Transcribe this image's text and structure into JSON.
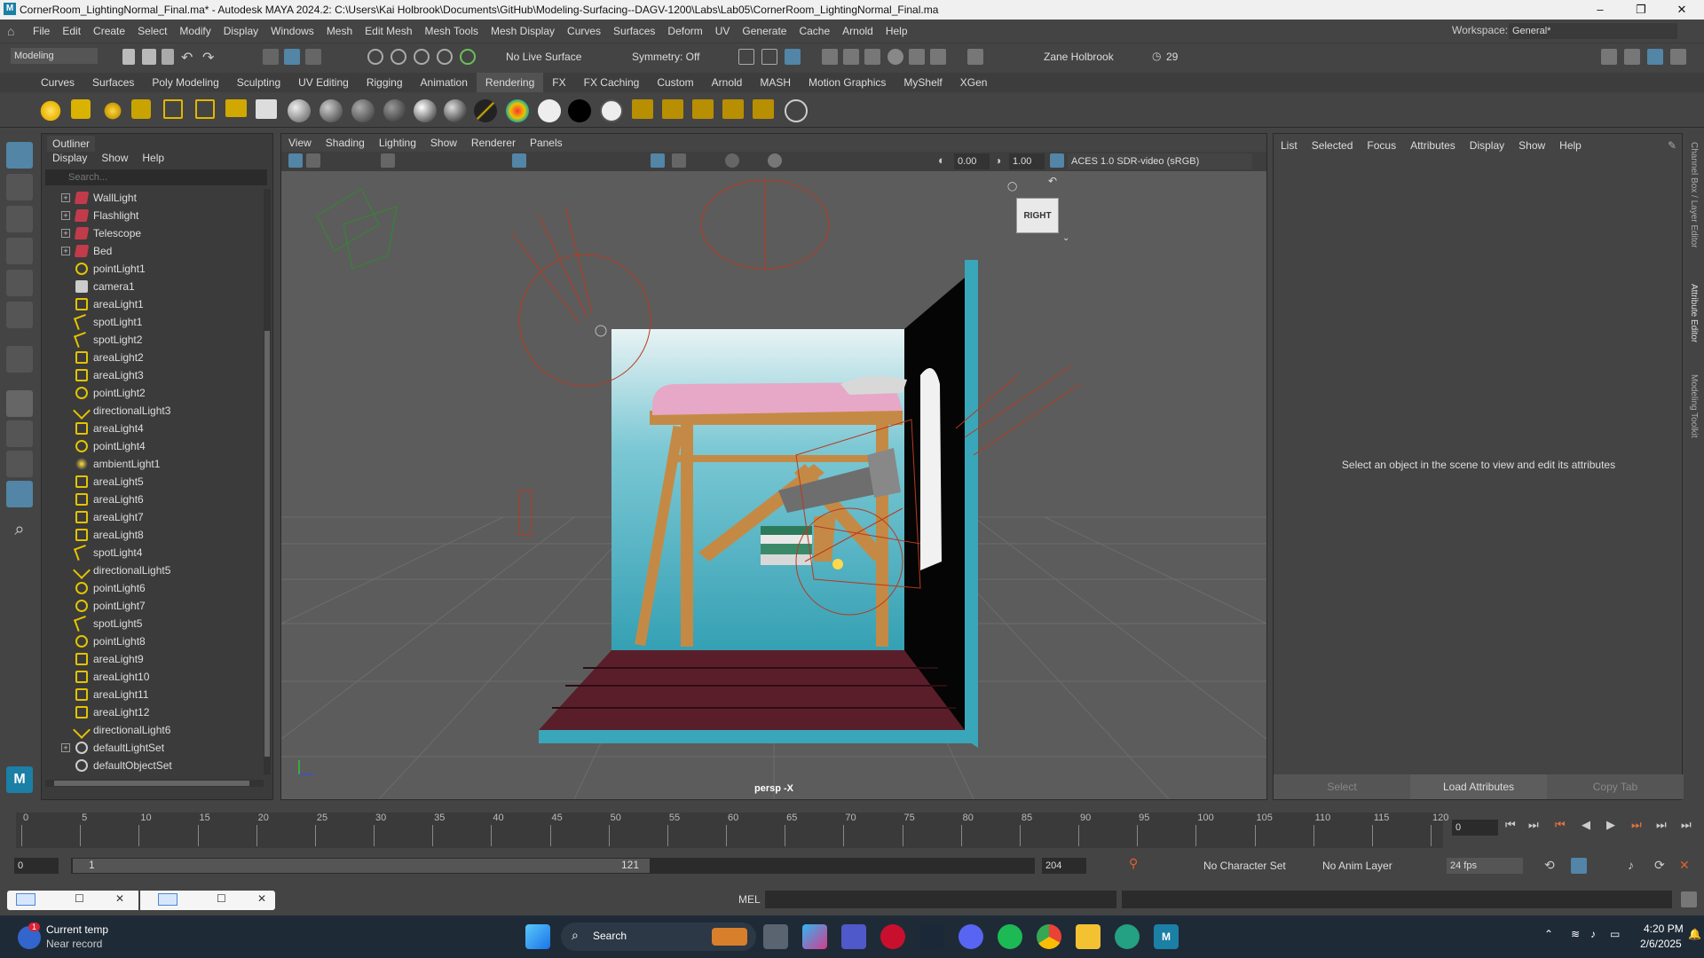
{
  "window": {
    "title": "CornerRoom_LightingNormal_Final.ma* - Autodesk MAYA 2024.2: C:\\Users\\Kai Holbrook\\Documents\\GitHub\\Modeling-Surfacing--DAGV-1200\\Labs\\Lab05\\CornerRoom_LightingNormal_Final.ma",
    "logo": "M",
    "minimize": "–",
    "restore": "❐",
    "close": "✕"
  },
  "menu": [
    "File",
    "Edit",
    "Create",
    "Select",
    "Modify",
    "Display",
    "Windows",
    "Mesh",
    "Edit Mesh",
    "Mesh Tools",
    "Mesh Display",
    "Curves",
    "Surfaces",
    "Deform",
    "UV",
    "Generate",
    "Cache",
    "Arnold",
    "Help"
  ],
  "workspace": {
    "label": "Workspace:",
    "value": "General*"
  },
  "status": {
    "mode": "Modeling",
    "live_surface": "No Live Surface",
    "symmetry": "Symmetry: Off",
    "user": "Zane Holbrook",
    "count": "29"
  },
  "shelf_tabs": [
    "Curves",
    "Surfaces",
    "Poly Modeling",
    "Sculpting",
    "UV Editing",
    "Rigging",
    "Animation",
    "Rendering",
    "FX",
    "FX Caching",
    "Custom",
    "Arnold",
    "MASH",
    "Motion Graphics",
    "MyShelf",
    "XGen"
  ],
  "shelf_active": "Rendering",
  "outliner": {
    "tab": "Outliner",
    "menu": [
      "Display",
      "Show",
      "Help"
    ],
    "search_placeholder": "Search...",
    "items": [
      {
        "label": "WallLight",
        "icon": "group-icon",
        "expand": true
      },
      {
        "label": "Flashlight",
        "icon": "group-icon",
        "expand": true
      },
      {
        "label": "Telescope",
        "icon": "group-icon",
        "expand": true
      },
      {
        "label": "Bed",
        "icon": "group-icon",
        "expand": true
      },
      {
        "label": "pointLight1",
        "icon": "point-light-icon"
      },
      {
        "label": "camera1",
        "icon": "camera-icon"
      },
      {
        "label": "areaLight1",
        "icon": "area-light-icon"
      },
      {
        "label": "spotLight1",
        "icon": "spot-light-icon"
      },
      {
        "label": "spotLight2",
        "icon": "spot-light-icon"
      },
      {
        "label": "areaLight2",
        "icon": "area-light-icon"
      },
      {
        "label": "areaLight3",
        "icon": "area-light-icon"
      },
      {
        "label": "pointLight2",
        "icon": "point-light-icon"
      },
      {
        "label": "directionalLight3",
        "icon": "directional-light-icon"
      },
      {
        "label": "areaLight4",
        "icon": "area-light-icon"
      },
      {
        "label": "pointLight4",
        "icon": "point-light-icon"
      },
      {
        "label": "ambientLight1",
        "icon": "ambient-light-icon"
      },
      {
        "label": "areaLight5",
        "icon": "area-light-icon"
      },
      {
        "label": "areaLight6",
        "icon": "area-light-icon"
      },
      {
        "label": "areaLight7",
        "icon": "area-light-icon"
      },
      {
        "label": "areaLight8",
        "icon": "area-light-icon"
      },
      {
        "label": "spotLight4",
        "icon": "spot-light-icon"
      },
      {
        "label": "directionalLight5",
        "icon": "directional-light-icon"
      },
      {
        "label": "pointLight6",
        "icon": "point-light-icon"
      },
      {
        "label": "pointLight7",
        "icon": "point-light-icon"
      },
      {
        "label": "spotLight5",
        "icon": "spot-light-icon"
      },
      {
        "label": "pointLight8",
        "icon": "point-light-icon"
      },
      {
        "label": "areaLight9",
        "icon": "area-light-icon"
      },
      {
        "label": "areaLight10",
        "icon": "area-light-icon"
      },
      {
        "label": "areaLight11",
        "icon": "area-light-icon"
      },
      {
        "label": "areaLight12",
        "icon": "area-light-icon"
      },
      {
        "label": "directionalLight6",
        "icon": "directional-light-icon"
      },
      {
        "label": "defaultLightSet",
        "icon": "set-icon",
        "expand": true
      },
      {
        "label": "defaultObjectSet",
        "icon": "set-icon"
      }
    ]
  },
  "viewport": {
    "menu": [
      "View",
      "Shading",
      "Lighting",
      "Show",
      "Renderer",
      "Panels"
    ],
    "exposure": "0.00",
    "gamma": "1.00",
    "colorspace": "ACES 1.0 SDR-video (sRGB)",
    "camera_label": "persp -X",
    "cube_label": "RIGHT"
  },
  "attribute_editor": {
    "menu": [
      "List",
      "Selected",
      "Focus",
      "Attributes",
      "Display",
      "Show",
      "Help"
    ],
    "message": "Select an object in the scene to view and edit its attributes",
    "buttons": [
      "Select",
      "Load Attributes",
      "Copy Tab"
    ],
    "side_tabs": [
      "Channel Box / Layer Editor",
      "Attribute Editor",
      "Modeling Toolkit"
    ]
  },
  "timeline": {
    "ticks": [
      "0",
      "5",
      "10",
      "15",
      "20",
      "25",
      "30",
      "35",
      "40",
      "45",
      "50",
      "55",
      "60",
      "65",
      "70",
      "75",
      "80",
      "85",
      "90",
      "95",
      "100",
      "105",
      "110",
      "115",
      "120"
    ],
    "current_frame": "0",
    "range_start": "0",
    "playback_start": "1",
    "playback_end": "121",
    "range_end": "204",
    "character_set": "No Character Set",
    "anim_layer": "No Anim Layer",
    "fps": "24 fps"
  },
  "command_line": {
    "label": "MEL"
  },
  "taskbar": {
    "weather_title": "Current temp",
    "weather_sub": "Near record",
    "weather_badge": "1",
    "search": "Search",
    "time": "4:20 PM",
    "date": "2/6/2025"
  },
  "colors": {
    "accent": "#5285a6",
    "maya_bg": "#444444",
    "viewport_bg": "#5c5c5c",
    "room_teal": "#3aa6b9",
    "wood": "#c48a45",
    "light_red": "#c0392b"
  }
}
